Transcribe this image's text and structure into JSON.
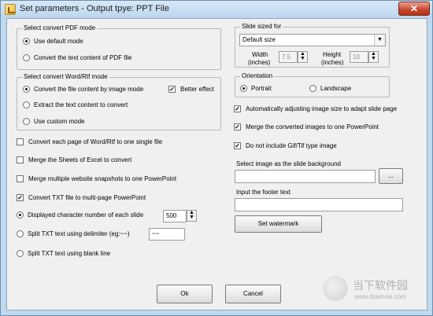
{
  "window": {
    "title": "Set parameters - Output tpye: PPT File",
    "close_glyph": "✕"
  },
  "pdf_mode": {
    "legend": "Select convert PDF mode",
    "options": [
      "Use default mode",
      "Convert the text content of PDF file"
    ],
    "selected": 0
  },
  "word_mode": {
    "legend": "Select convert Word/Rtf mode",
    "options": [
      "Convert the file content by image mode",
      "Extract the text content to convert",
      "Use custom mode"
    ],
    "selected": 0,
    "better_effect_label": "Better effect",
    "better_effect_checked": true
  },
  "left_options": {
    "each_page_label": "Convert each page of Word/Rtf to one single file",
    "each_page_checked": false,
    "merge_sheets_label": "Merge the Sheets of Excel to convert",
    "merge_sheets_checked": false,
    "merge_snapshots_label": "Merge multiple website snapshots to one PowerPoint",
    "merge_snapshots_checked": false,
    "txt_multipage_label": "Convert TXT file to multi-page PowerPoint",
    "txt_multipage_checked": true
  },
  "txt_split": {
    "char_count_label": "Displayed character number of each slide",
    "char_count_value": "500",
    "delimiter_label": "Split TXT text using delimiter (eg:~~)",
    "delimiter_value": "~~",
    "blank_line_label": "Split TXT text using blank line",
    "selected": 0
  },
  "slide_size": {
    "legend": "Slide sized for",
    "selected": "Default size",
    "width_label": "Width",
    "width_unit": "(inches)",
    "width_value": "7.5",
    "height_label": "Height",
    "height_unit": "(inches)",
    "height_value": "10"
  },
  "orientation": {
    "legend": "Orientation",
    "options": [
      "Portrait",
      "Landscape"
    ],
    "selected": 0
  },
  "right_options": {
    "auto_adjust_label": "Automatically adjusting image size to adapt slide page",
    "auto_adjust_checked": true,
    "merge_images_label": "Merge the converted images to one PowerPoint",
    "merge_images_checked": true,
    "no_gif_label": "Do not include Gif/Tif type image",
    "no_gif_checked": true
  },
  "background": {
    "label": "Select image as the slide background",
    "value": "",
    "browse_label": "..."
  },
  "footer": {
    "label": "Input the footer text",
    "value": ""
  },
  "buttons": {
    "set_watermark": "Set watermark",
    "ok": "Ok",
    "cancel": "Cancel"
  },
  "site_watermark": {
    "name": "当下软件园",
    "url": "www.downxia.com"
  },
  "colors": {
    "frame": "#bfd9ef",
    "client": "#f0f0f0",
    "close": "#c7432a"
  }
}
